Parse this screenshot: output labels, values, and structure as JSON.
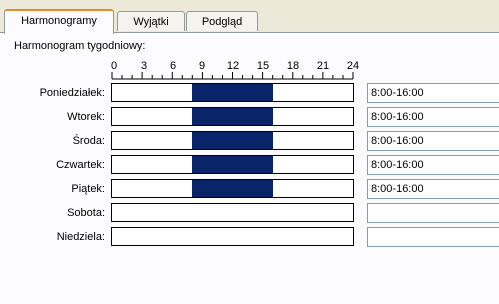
{
  "tabs": [
    {
      "label": "Harmonogramy",
      "active": true
    },
    {
      "label": "Wyjątki",
      "active": false
    },
    {
      "label": "Podgląd",
      "active": false
    }
  ],
  "heading": "Harmonogram tygodniowy:",
  "ruler": {
    "ticks": [
      "0",
      "3",
      "6",
      "9",
      "12",
      "15",
      "18",
      "21",
      "24"
    ]
  },
  "days": [
    {
      "label": "Poniedziałek:",
      "value": "8:00-16:00",
      "start": 8,
      "end": 16
    },
    {
      "label": "Wtorek:",
      "value": "8:00-16:00",
      "start": 8,
      "end": 16
    },
    {
      "label": "Środa:",
      "value": "8:00-16:00",
      "start": 8,
      "end": 16
    },
    {
      "label": "Czwartek:",
      "value": "8:00-16:00",
      "start": 8,
      "end": 16
    },
    {
      "label": "Piątek:",
      "value": "8:00-16:00",
      "start": 8,
      "end": 16
    },
    {
      "label": "Sobota:",
      "value": "",
      "start": null,
      "end": null
    },
    {
      "label": "Niedziela:",
      "value": "",
      "start": null,
      "end": null
    }
  ],
  "colors": {
    "fill": "#0a246a",
    "tab_accent": "#e68b2c"
  }
}
